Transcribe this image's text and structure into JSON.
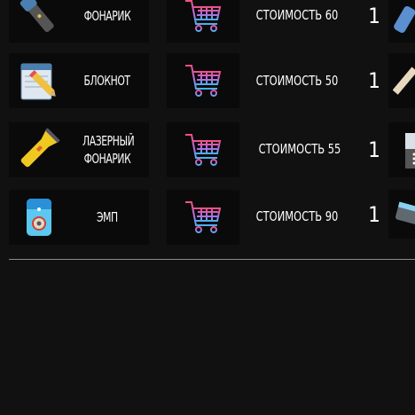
{
  "items": [
    {
      "name": "ФОНАРИК",
      "price_label": "СТОИМОСТЬ 60",
      "count": "1",
      "icon": "flashlight-icon"
    },
    {
      "name": "БЛОКНОТ",
      "price_label": "СТОИМОСТЬ 50",
      "count": "1",
      "icon": "notepad-icon"
    },
    {
      "name": "ЛАЗЕРНЫЙ ФОНАРИК",
      "price_label": "СТОИМОСТЬ 55",
      "count": "1",
      "icon": "laser-flashlight-icon"
    },
    {
      "name": "ЭМП",
      "price_label": "СТОИМОСТЬ 90",
      "count": "1",
      "icon": "emp-device-icon"
    }
  ],
  "colors": {
    "background": "#111111",
    "card": "#0a0a0a",
    "cart_pink": "#f0508a",
    "cart_blue": "#4ab0f0",
    "divider": "#8a8a8a"
  }
}
